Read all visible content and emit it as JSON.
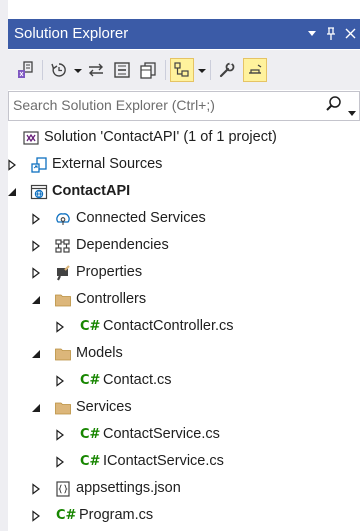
{
  "panel": {
    "title": "Solution Explorer",
    "dropdown_glyph": "▾",
    "pin_glyph": "ᵖ",
    "close_glyph": "✕"
  },
  "search": {
    "placeholder": "Search Solution Explorer (Ctrl+;)"
  },
  "colors": {
    "title_bar": "#3B5BA7",
    "folder": "#DCB67A",
    "csharp": "#178600",
    "active_toggle": "#FFF29D"
  },
  "toolbar": {
    "icons": [
      "switch-view-icon",
      "history-icon",
      "sync-icon",
      "collapse-all-icon",
      "show-all-files-icon",
      "preview-selected-icon",
      "properties-icon",
      "preview-icon"
    ]
  },
  "tree": {
    "solution": "Solution 'ContactAPI' (1 of 1 project)",
    "external_sources": "External Sources",
    "project": "ContactAPI",
    "connected_services": "Connected Services",
    "dependencies": "Dependencies",
    "properties": "Properties",
    "controllers": "Controllers",
    "contact_controller": "ContactController.cs",
    "models": "Models",
    "contact": "Contact.cs",
    "services": "Services",
    "contact_service": "ContactService.cs",
    "icontact_service": "IContactService.cs",
    "appsettings": "appsettings.json",
    "program": "Program.cs",
    "cs_glyph": "C#"
  }
}
